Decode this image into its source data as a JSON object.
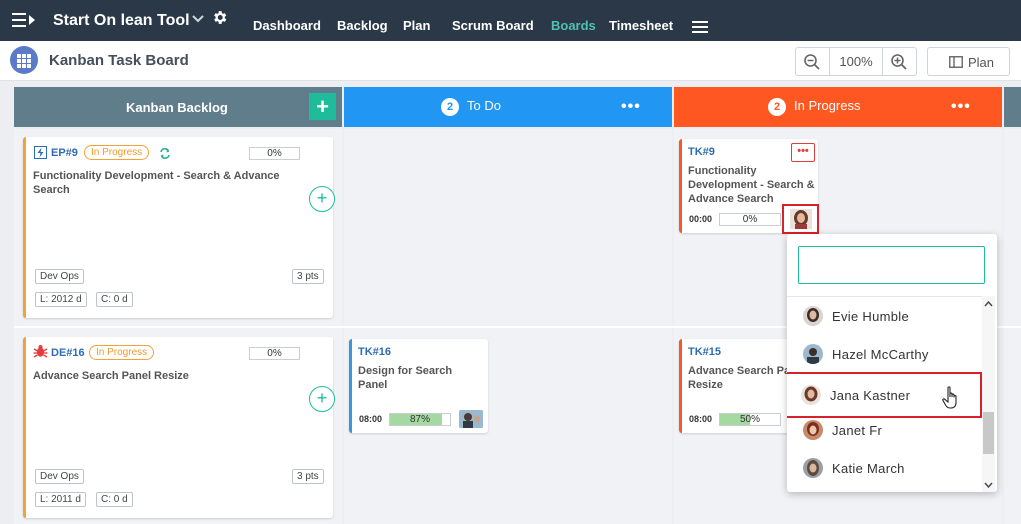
{
  "app": {
    "title": "Start On lean Tool"
  },
  "nav": {
    "items": [
      "Dashboard",
      "Backlog",
      "Plan",
      "Scrum Board",
      "Boards",
      "Timesheet"
    ],
    "active": "Boards"
  },
  "subheader": {
    "title": "Kanban Task Board",
    "zoom": "100%",
    "plan_label": "Plan"
  },
  "columns": {
    "backlog": {
      "title": "Kanban Backlog",
      "color": "#607d8b"
    },
    "todo": {
      "title": "To Do",
      "count": "2",
      "color": "#2196f3"
    },
    "progress": {
      "title": "In Progress",
      "count": "2",
      "color": "#fe5722"
    }
  },
  "backlog_cards": [
    {
      "id": "EP#9",
      "status": "In Progress",
      "pct": "0%",
      "title": "Functionality Development - Search & Advance Search",
      "tag": "Dev Ops",
      "pts": "3 pts",
      "l": "L: 2012 d",
      "c": "C: 0 d"
    },
    {
      "id": "DE#16",
      "status": "In Progress",
      "pct": "0%",
      "title": "Advance Search Panel Resize",
      "tag": "Dev Ops",
      "pts": "3 pts",
      "l": "L: 2011 d",
      "c": "C: 0 d"
    }
  ],
  "todo_cards": [
    {
      "id": "TK#16",
      "title": "Design for Search Panel",
      "time": "08:00",
      "pct": "87%",
      "progress": 0.87
    }
  ],
  "progress_cards": [
    {
      "id": "TK#9",
      "title": "Functionality Development - Search & Advance Search",
      "time": "00:00",
      "pct": "0%",
      "progress": 0
    },
    {
      "id": "TK#15",
      "title": "Advance Search Panel Resize",
      "time": "08:00",
      "pct": "50%",
      "progress": 0.5
    }
  ],
  "assignee_dropdown": {
    "search_value": "",
    "users": [
      "Evie Humble",
      "Hazel McCarthy",
      "Jana Kastner",
      "Janet Fr",
      "Katie March"
    ],
    "selected": "Jana Kastner"
  },
  "icons": [
    "menu-toggle-icon",
    "chevron-down-icon",
    "gear-icon",
    "hamburger-icon",
    "grid-icon",
    "zoom-out-icon",
    "zoom-in-icon",
    "columns-icon",
    "epic-icon",
    "bug-icon",
    "sync-icon",
    "hand-cursor-icon"
  ]
}
